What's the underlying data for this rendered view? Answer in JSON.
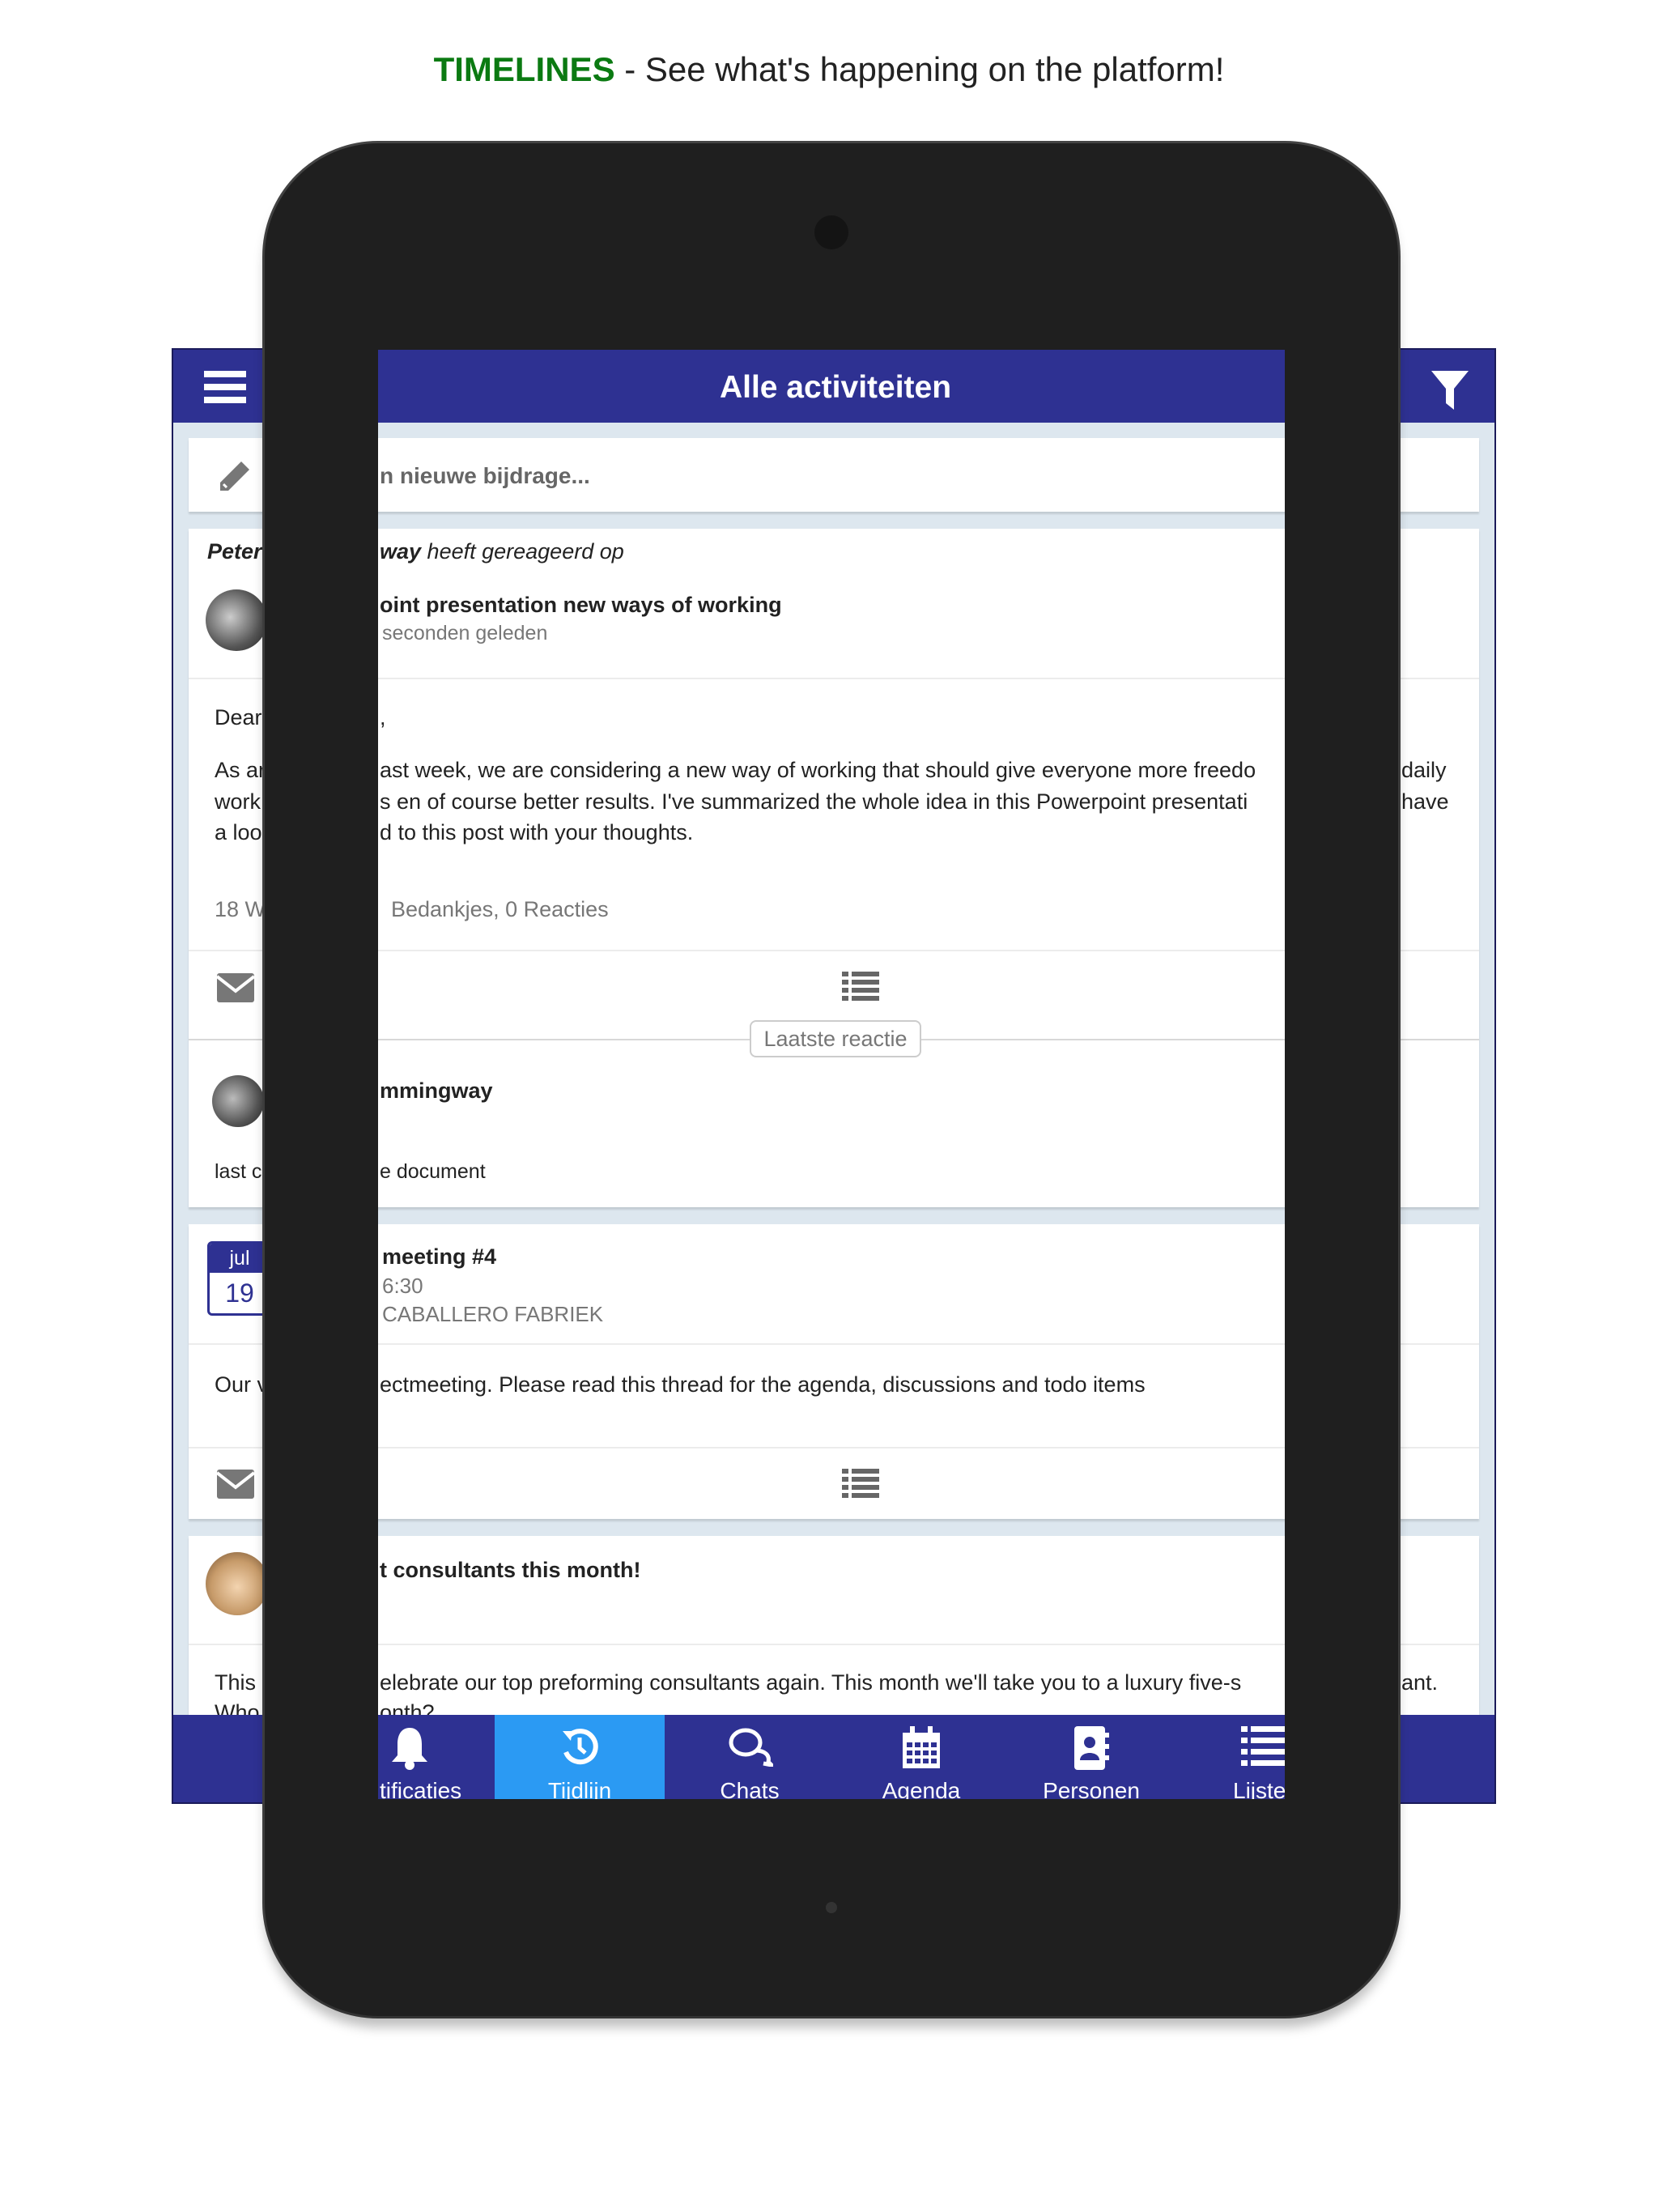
{
  "headline": {
    "brand": "TIMELINES",
    "tagline": " - See what's happening on the platform!"
  },
  "colors": {
    "brand_green": "#0b7a12",
    "header": "#2e3192",
    "active_tab": "#2b9af3",
    "background": "#dde7ef"
  },
  "header": {
    "title": "Alle activiteiten",
    "menu_icon": "hamburger-icon",
    "filter_icon": "filter-icon"
  },
  "composer": {
    "placeholder": "n nieuwe bijdrage..."
  },
  "post1": {
    "actor_left": "Peter",
    "actor_right": "way",
    "action": " heeft gereageerd op",
    "title": "oint presentation new ways of working",
    "time": "seconden geleden",
    "greeting_left": "Dear",
    "greeting_right": ",",
    "body_left": [
      "As ar",
      "work",
      "a loo"
    ],
    "body_mid": [
      "ast week, we are considering a new way of working that should give everyone more freedo",
      "s en of course better results. I've summarized the whole idea in this Powerpoint presentati",
      "d to this post with your thoughts."
    ],
    "body_right": [
      "daily",
      "have"
    ],
    "stats_left": "18 W",
    "stats_right": "Bedankjes, 0 Reacties",
    "latest_label": "Laatste reactie",
    "reply_author": "mmingway",
    "reply_left": "last c",
    "reply_right": "e document"
  },
  "event": {
    "month": "jul",
    "day": "19",
    "title": "meeting #4",
    "time": "6:30",
    "location": "CABALLERO FABRIEK",
    "body_left": "Our v",
    "body_right": "ectmeeting. Please read this thread for the agenda, discussions and todo items"
  },
  "post3": {
    "title": "t consultants this month!",
    "line1_left": "This",
    "line1_mid": "elebrate our top preforming consultants again. This month we'll take you to a luxury five-s",
    "line1_right": "ant.",
    "line2_left": "Who",
    "line2_mid": "onth?"
  },
  "nav": [
    {
      "label": "tificaties",
      "icon": "bell-icon"
    },
    {
      "label": "Tijdlijn",
      "icon": "history-icon",
      "active": true
    },
    {
      "label": "Chats",
      "icon": "chat-bubbles-icon"
    },
    {
      "label": "Agenda",
      "icon": "calendar-icon"
    },
    {
      "label": "Personen",
      "icon": "contact-book-icon"
    },
    {
      "label": "Lijste",
      "icon": "list-icon"
    }
  ]
}
